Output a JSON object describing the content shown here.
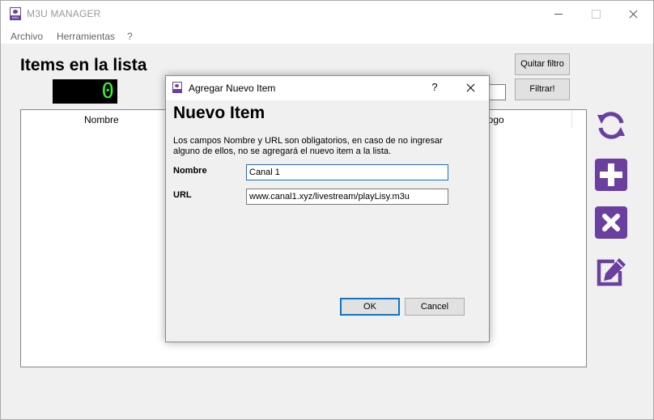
{
  "window": {
    "title": "M3U MANAGER"
  },
  "menu": {
    "items": [
      "Archivo",
      "Herramientas",
      "?"
    ]
  },
  "main": {
    "heading": "Items en la lista",
    "counter_value": "0",
    "filter_buttons": {
      "remove_filter": "Quitar filtro",
      "apply_filter": "Filtrar!"
    },
    "list_columns": [
      "Nombre",
      "Logo"
    ]
  },
  "actions": {
    "icons": [
      "refresh-icon",
      "add-icon",
      "delete-icon",
      "edit-icon"
    ],
    "accent_color": "#6b3fa0"
  },
  "dialog": {
    "title": "Agregar Nuevo Item",
    "help": "?",
    "heading": "Nuevo Item",
    "description": "Los campos Nombre y URL son obligatorios, en caso de no ingresar alguno de ellos, no se agregará el nuevo item a la lista.",
    "fields": {
      "name_label": "Nombre",
      "name_value": "Canal 1",
      "url_label": "URL",
      "url_value": "www.canal1.xyz/livestream/playLisy.m3u"
    },
    "buttons": {
      "ok": "OK",
      "cancel": "Cancel"
    }
  },
  "colors": {
    "focus_border": "#0078d7",
    "counter_digit": "#35f535"
  }
}
